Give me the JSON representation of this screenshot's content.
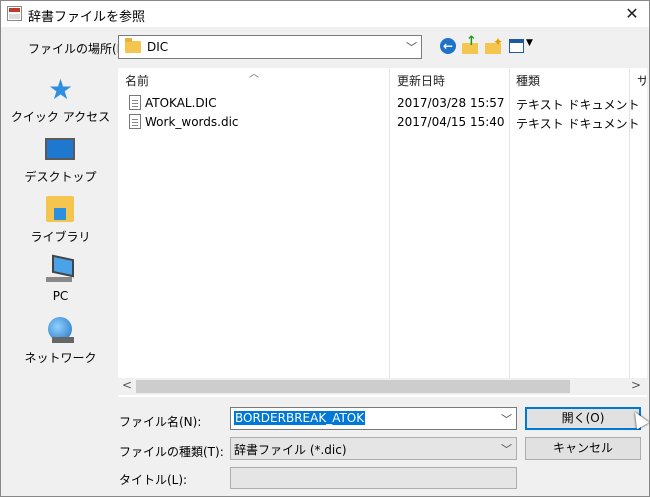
{
  "window": {
    "title": "辞書ファイルを参照",
    "close_glyph": "✕"
  },
  "location": {
    "label": "ファイルの場所(I):",
    "value": "DIC"
  },
  "places": [
    {
      "label": "クイック アクセス",
      "icon": "quick-access-star-icon"
    },
    {
      "label": "デスクトップ",
      "icon": "desktop-icon"
    },
    {
      "label": "ライブラリ",
      "icon": "libraries-icon"
    },
    {
      "label": "PC",
      "icon": "pc-icon"
    },
    {
      "label": "ネットワーク",
      "icon": "network-icon"
    }
  ],
  "filelist": {
    "columns": [
      {
        "label": "名前"
      },
      {
        "label": "更新日時"
      },
      {
        "label": "種類"
      },
      {
        "label": "サ"
      }
    ],
    "rows": [
      {
        "name": "ATOKAL.DIC",
        "date": "2017/03/28 15:57",
        "type": "テキスト ドキュメント"
      },
      {
        "name": "Work_words.dic",
        "date": "2017/04/15 15:40",
        "type": "テキスト ドキュメント"
      }
    ]
  },
  "filename": {
    "label": "ファイル名(N):",
    "value": "BORDERBREAK_ATOK"
  },
  "filetype": {
    "label": "ファイルの種類(T):",
    "value": "辞書ファイル (*.dic)"
  },
  "title_field": {
    "label": "タイトル(L):",
    "value": ""
  },
  "buttons": {
    "open": "開く(O)",
    "cancel": "キャンセル"
  },
  "colors": {
    "accent": "#0078d7",
    "selection": "#0078d7"
  }
}
